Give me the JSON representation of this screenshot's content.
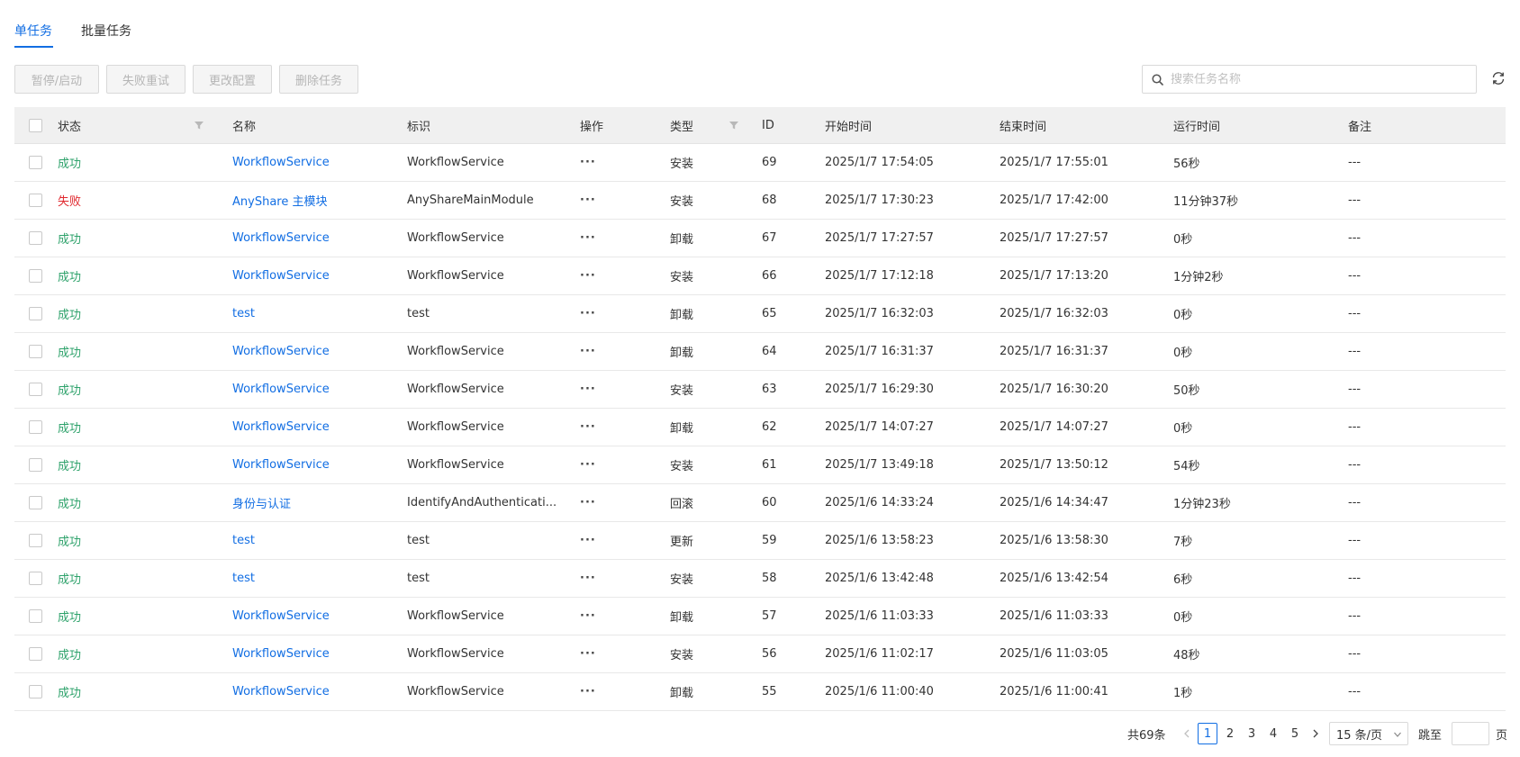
{
  "tabs": [
    {
      "label": "单任务",
      "active": true
    },
    {
      "label": "批量任务",
      "active": false
    }
  ],
  "toolbar": {
    "pause_label": "暂停/启动",
    "retry_label": "失败重试",
    "config_label": "更改配置",
    "delete_label": "删除任务"
  },
  "search": {
    "placeholder": "搜索任务名称",
    "value": ""
  },
  "table": {
    "headers": {
      "status": "状态",
      "name": "名称",
      "mark": "标识",
      "op": "操作",
      "type": "类型",
      "id": "ID",
      "start": "开始时间",
      "end": "结束时间",
      "duration": "运行时间",
      "note": "备注"
    },
    "op_label": "···",
    "rows": [
      {
        "status": "成功",
        "state": "ok",
        "name": "WorkflowService",
        "mark": "WorkflowService",
        "type": "安装",
        "id": "69",
        "start": "2025/1/7 17:54:05",
        "end": "2025/1/7 17:55:01",
        "duration": "56秒",
        "note": "---"
      },
      {
        "status": "失败",
        "state": "fail",
        "name": "AnyShare 主模块",
        "mark": "AnyShareMainModule",
        "type": "安装",
        "id": "68",
        "start": "2025/1/7 17:30:23",
        "end": "2025/1/7 17:42:00",
        "duration": "11分钟37秒",
        "note": "---"
      },
      {
        "status": "成功",
        "state": "ok",
        "name": "WorkflowService",
        "mark": "WorkflowService",
        "type": "卸载",
        "id": "67",
        "start": "2025/1/7 17:27:57",
        "end": "2025/1/7 17:27:57",
        "duration": "0秒",
        "note": "---"
      },
      {
        "status": "成功",
        "state": "ok",
        "name": "WorkflowService",
        "mark": "WorkflowService",
        "type": "安装",
        "id": "66",
        "start": "2025/1/7 17:12:18",
        "end": "2025/1/7 17:13:20",
        "duration": "1分钟2秒",
        "note": "---"
      },
      {
        "status": "成功",
        "state": "ok",
        "name": "test",
        "mark": "test",
        "type": "卸载",
        "id": "65",
        "start": "2025/1/7 16:32:03",
        "end": "2025/1/7 16:32:03",
        "duration": "0秒",
        "note": "---"
      },
      {
        "status": "成功",
        "state": "ok",
        "name": "WorkflowService",
        "mark": "WorkflowService",
        "type": "卸载",
        "id": "64",
        "start": "2025/1/7 16:31:37",
        "end": "2025/1/7 16:31:37",
        "duration": "0秒",
        "note": "---"
      },
      {
        "status": "成功",
        "state": "ok",
        "name": "WorkflowService",
        "mark": "WorkflowService",
        "type": "安装",
        "id": "63",
        "start": "2025/1/7 16:29:30",
        "end": "2025/1/7 16:30:20",
        "duration": "50秒",
        "note": "---"
      },
      {
        "status": "成功",
        "state": "ok",
        "name": "WorkflowService",
        "mark": "WorkflowService",
        "type": "卸载",
        "id": "62",
        "start": "2025/1/7 14:07:27",
        "end": "2025/1/7 14:07:27",
        "duration": "0秒",
        "note": "---"
      },
      {
        "status": "成功",
        "state": "ok",
        "name": "WorkflowService",
        "mark": "WorkflowService",
        "type": "安装",
        "id": "61",
        "start": "2025/1/7 13:49:18",
        "end": "2025/1/7 13:50:12",
        "duration": "54秒",
        "note": "---"
      },
      {
        "status": "成功",
        "state": "ok",
        "name": "身份与认证",
        "mark": "IdentifyAndAuthenticati...",
        "type": "回滚",
        "id": "60",
        "start": "2025/1/6 14:33:24",
        "end": "2025/1/6 14:34:47",
        "duration": "1分钟23秒",
        "note": "---"
      },
      {
        "status": "成功",
        "state": "ok",
        "name": "test",
        "mark": "test",
        "type": "更新",
        "id": "59",
        "start": "2025/1/6 13:58:23",
        "end": "2025/1/6 13:58:30",
        "duration": "7秒",
        "note": "---"
      },
      {
        "status": "成功",
        "state": "ok",
        "name": "test",
        "mark": "test",
        "type": "安装",
        "id": "58",
        "start": "2025/1/6 13:42:48",
        "end": "2025/1/6 13:42:54",
        "duration": "6秒",
        "note": "---"
      },
      {
        "status": "成功",
        "state": "ok",
        "name": "WorkflowService",
        "mark": "WorkflowService",
        "type": "卸载",
        "id": "57",
        "start": "2025/1/6 11:03:33",
        "end": "2025/1/6 11:03:33",
        "duration": "0秒",
        "note": "---"
      },
      {
        "status": "成功",
        "state": "ok",
        "name": "WorkflowService",
        "mark": "WorkflowService",
        "type": "安装",
        "id": "56",
        "start": "2025/1/6 11:02:17",
        "end": "2025/1/6 11:03:05",
        "duration": "48秒",
        "note": "---"
      },
      {
        "status": "成功",
        "state": "ok",
        "name": "WorkflowService",
        "mark": "WorkflowService",
        "type": "卸载",
        "id": "55",
        "start": "2025/1/6 11:00:40",
        "end": "2025/1/6 11:00:41",
        "duration": "1秒",
        "note": "---"
      }
    ]
  },
  "pagination": {
    "total": "共69条",
    "pages": [
      "1",
      "2",
      "3",
      "4",
      "5"
    ],
    "current": "1",
    "page_size": "15 条/页",
    "jump_label": "跳至",
    "page_unit": "页"
  },
  "colors": {
    "accent": "#126ee3",
    "success": "#2ea26b",
    "fail": "#e0282e"
  }
}
